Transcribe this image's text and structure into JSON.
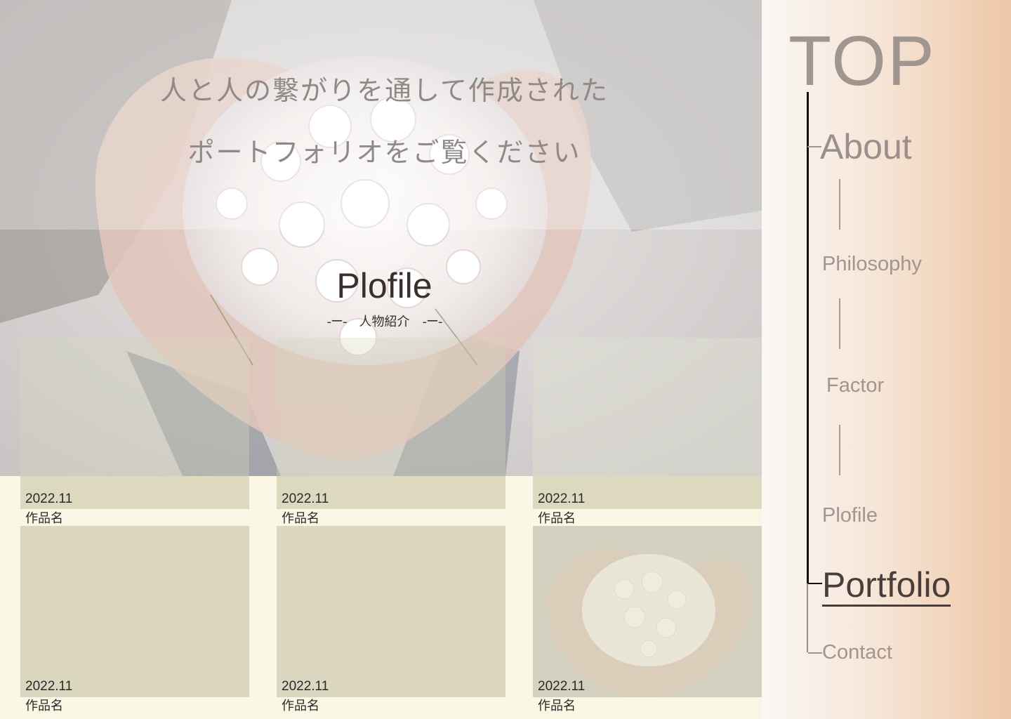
{
  "hero": {
    "line1": "人と人の繋がりを通して作成された",
    "line2": "ポートフォリオをご覧ください"
  },
  "section": {
    "title": "Plofile",
    "dash_left": "-ー-",
    "subtitle": "人物紹介",
    "dash_right": "-ー-"
  },
  "works": [
    {
      "date": "2022.11",
      "name": "作品名"
    },
    {
      "date": "2022.11",
      "name": "作品名"
    },
    {
      "date": "2022.11",
      "name": "作品名"
    },
    {
      "date": "2022.11",
      "name": "作品名"
    },
    {
      "date": "2022.11",
      "name": "作品名"
    },
    {
      "date": "2022.11",
      "name": "作品名"
    }
  ],
  "nav": {
    "top": "TOP",
    "about": "About",
    "philosophy": "Philosophy",
    "factor": "Factor",
    "plofile": "Plofile",
    "portfolio": "Portfolio",
    "contact": "Contact",
    "active": "Portfolio"
  },
  "colors": {
    "cream": "#faf7e4",
    "card": "#dcd9bf",
    "nav_gradient_end": "#eec7a6",
    "active_text": "#4a3e3c"
  }
}
